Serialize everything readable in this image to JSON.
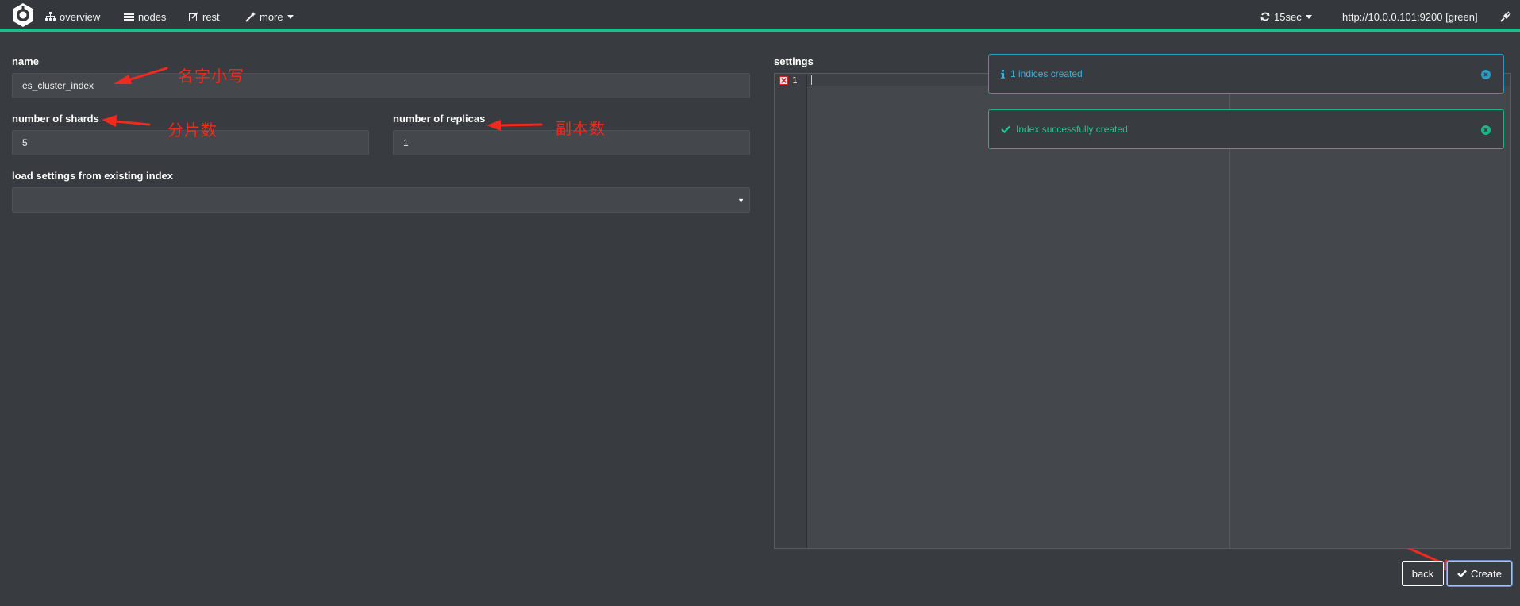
{
  "navbar": {
    "items": [
      {
        "label": "overview",
        "icon": "sitemap-icon"
      },
      {
        "label": "nodes",
        "icon": "server-icon"
      },
      {
        "label": "rest",
        "icon": "edit-icon"
      },
      {
        "label": "more",
        "icon": "magic-wand-icon"
      }
    ],
    "refresh_label": "15sec",
    "cluster_url": "http://10.0.0.101:9200 [green]",
    "accent_color": "#19c28b"
  },
  "form": {
    "name_label": "name",
    "name_value": "es_cluster_index",
    "shards_label": "number of shards",
    "shards_value": "5",
    "replicas_label": "number of replicas",
    "replicas_value": "1",
    "load_settings_label": "load settings from existing index",
    "load_settings_value": ""
  },
  "annotations": {
    "name_note": "名字小写",
    "shards_note": "分片数",
    "replicas_note": "副本数",
    "color": "#f02a1d"
  },
  "settings": {
    "label": "settings",
    "line_number": "1"
  },
  "toasts": [
    {
      "type": "info",
      "text": "1 indices created",
      "color": "#2d9cc4"
    },
    {
      "type": "success",
      "text": "Index successfully created",
      "color": "#19b884"
    }
  ],
  "buttons": {
    "back_label": "back",
    "create_label": "Create"
  }
}
